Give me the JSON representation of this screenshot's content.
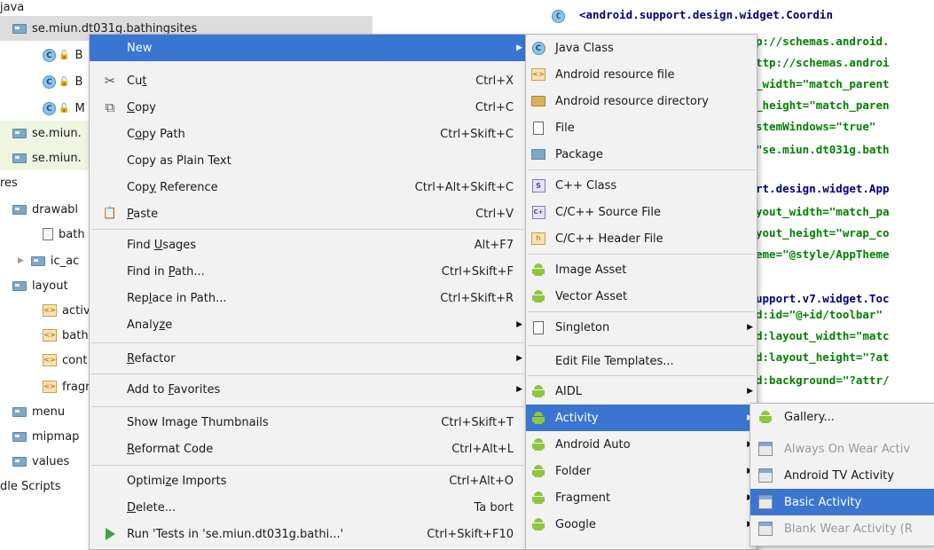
{
  "tree": {
    "rows": [
      {
        "label": "java",
        "kind": "text"
      },
      {
        "label": "se.miun.dt031g.bathingsites",
        "kind": "pkg"
      },
      {
        "label": "B",
        "kind": "class"
      },
      {
        "label": "B",
        "kind": "class"
      },
      {
        "label": "M",
        "kind": "class"
      },
      {
        "label": "se.miun.",
        "kind": "pkg"
      },
      {
        "label": "se.miun.",
        "kind": "pkg"
      },
      {
        "label": "res",
        "kind": "text"
      },
      {
        "label": "drawabl",
        "kind": "folder"
      },
      {
        "label": "bath",
        "kind": "img"
      },
      {
        "label": "ic_ac",
        "kind": "folderarrow"
      },
      {
        "label": "layout",
        "kind": "folder"
      },
      {
        "label": "activ",
        "kind": "layout"
      },
      {
        "label": "bath",
        "kind": "layout"
      },
      {
        "label": "cont",
        "kind": "layout"
      },
      {
        "label": "fragr",
        "kind": "layout"
      },
      {
        "label": "menu",
        "kind": "folder"
      },
      {
        "label": "mipmap",
        "kind": "folder"
      },
      {
        "label": "values",
        "kind": "folder"
      },
      {
        "label": "dle Scripts",
        "kind": "text"
      }
    ]
  },
  "editor": {
    "lines": [
      {
        "kind": "tag",
        "text": "<android.support.design.widget.Coordin"
      },
      {
        "kind": "attr",
        "text": "p://schemas.android."
      },
      {
        "kind": "attr",
        "text": "ttp://schemas.androi"
      },
      {
        "kind": "attr",
        "text": "_width=\"match_parent"
      },
      {
        "kind": "attr",
        "text": "_height=\"match_paren"
      },
      {
        "kind": "attr",
        "text": "stemWindows=\"true\""
      },
      {
        "kind": "attr",
        "text": "\"se.miun.dt031g.bath"
      },
      {
        "kind": "blank",
        "text": ""
      },
      {
        "kind": "tag",
        "text": "rt.design.widget.App"
      },
      {
        "kind": "attr",
        "text": "yout_width=\"match_pa"
      },
      {
        "kind": "attr",
        "text": "yout_height=\"wrap_co"
      },
      {
        "kind": "attr",
        "text": "eme=\"@style/AppTheme"
      },
      {
        "kind": "blank",
        "text": ""
      },
      {
        "kind": "tag",
        "text": "upport.v7.widget.Toc"
      },
      {
        "kind": "attr",
        "text": "d:id=\"@+id/toolbar\""
      },
      {
        "kind": "attr",
        "text": "d:layout_width=\"matc"
      },
      {
        "kind": "attr",
        "text": "d:layout_height=\"?at"
      },
      {
        "kind": "attr",
        "text": "d:background=\"?attr/"
      }
    ]
  },
  "context_menu": {
    "items": [
      {
        "label": "New",
        "shortcut": "",
        "submenu": true,
        "active": true,
        "icon": "none"
      },
      {
        "label": "Cut",
        "shortcut": "Ctrl+X",
        "icon": "scissors-icon"
      },
      {
        "label": "Copy",
        "shortcut": "Ctrl+C",
        "icon": "copy-icon"
      },
      {
        "label": "Copy Path",
        "shortcut": "Ctrl+Skift+C",
        "icon": "none"
      },
      {
        "label": "Copy as Plain Text",
        "shortcut": "",
        "icon": "none"
      },
      {
        "label": "Copy Reference",
        "shortcut": "Ctrl+Alt+Skift+C",
        "icon": "none"
      },
      {
        "label": "Paste",
        "shortcut": "Ctrl+V",
        "icon": "paste-icon"
      },
      {
        "sep": true
      },
      {
        "label": "Find Usages",
        "shortcut": "Alt+F7",
        "icon": "none"
      },
      {
        "label": "Find in Path...",
        "shortcut": "Ctrl+Skift+F",
        "icon": "none"
      },
      {
        "label": "Replace in Path...",
        "shortcut": "Ctrl+Skift+R",
        "icon": "none"
      },
      {
        "label": "Analyze",
        "shortcut": "",
        "submenu": true,
        "icon": "none"
      },
      {
        "sep": true
      },
      {
        "label": "Refactor",
        "shortcut": "",
        "submenu": true,
        "icon": "none"
      },
      {
        "sep": true
      },
      {
        "label": "Add to Favorites",
        "shortcut": "",
        "submenu": true,
        "icon": "none"
      },
      {
        "label": "Show Image Thumbnails",
        "shortcut": "Ctrl+Skift+T",
        "icon": "none"
      },
      {
        "sep": true
      },
      {
        "label": "Reformat Code",
        "shortcut": "Ctrl+Alt+L",
        "icon": "none"
      },
      {
        "label": "Optimize Imports",
        "shortcut": "Ctrl+Alt+O",
        "icon": "none"
      },
      {
        "label": "Delete...",
        "shortcut": "Ta bort",
        "icon": "none"
      },
      {
        "sep": true
      },
      {
        "label": "Run 'Tests in 'se.miun.dt031g.bathi...'",
        "shortcut": "Ctrl+Skift+F10",
        "icon": "run-icon"
      }
    ]
  },
  "new_menu": {
    "items": [
      {
        "label": "Java Class",
        "icon": "class-icon"
      },
      {
        "label": "Android resource file",
        "icon": "resource-file-icon"
      },
      {
        "label": "Android resource directory",
        "icon": "folder-icon"
      },
      {
        "label": "File",
        "icon": "file-icon"
      },
      {
        "label": "Package",
        "icon": "package-icon"
      },
      {
        "sep": true
      },
      {
        "label": "C++ Class",
        "icon": "cpp-class-icon"
      },
      {
        "label": "C/C++ Source File",
        "icon": "cpp-source-icon"
      },
      {
        "label": "C/C++ Header File",
        "icon": "cpp-header-icon"
      },
      {
        "sep": true
      },
      {
        "label": "Image Asset",
        "icon": "android-icon"
      },
      {
        "label": "Vector Asset",
        "icon": "android-icon"
      },
      {
        "sep": true
      },
      {
        "label": "Singleton",
        "icon": "singleton-icon",
        "submenu": true
      },
      {
        "sep": true
      },
      {
        "label": "Edit File Templates...",
        "icon": "none"
      },
      {
        "sep": true
      },
      {
        "label": "AIDL",
        "icon": "android-icon",
        "submenu": true
      },
      {
        "label": "Activity",
        "icon": "android-icon",
        "submenu": true,
        "active": true
      },
      {
        "label": "Android Auto",
        "icon": "android-icon",
        "submenu": true
      },
      {
        "label": "Folder",
        "icon": "android-icon",
        "submenu": true
      },
      {
        "label": "Fragment",
        "icon": "android-icon",
        "submenu": true
      },
      {
        "label": "Google",
        "icon": "android-icon",
        "submenu": true
      }
    ]
  },
  "activity_menu": {
    "items": [
      {
        "label": "Gallery...",
        "icon": "android-icon"
      },
      {
        "label": "Always On Wear Activ",
        "icon": "activity-template-icon",
        "disabled": true
      },
      {
        "label": "Android TV Activity",
        "icon": "activity-template-icon"
      },
      {
        "label": "Basic Activity",
        "icon": "activity-template-icon",
        "active": true
      },
      {
        "label": "Blank Wear Activity (R",
        "icon": "activity-template-icon",
        "disabled": true
      }
    ]
  }
}
